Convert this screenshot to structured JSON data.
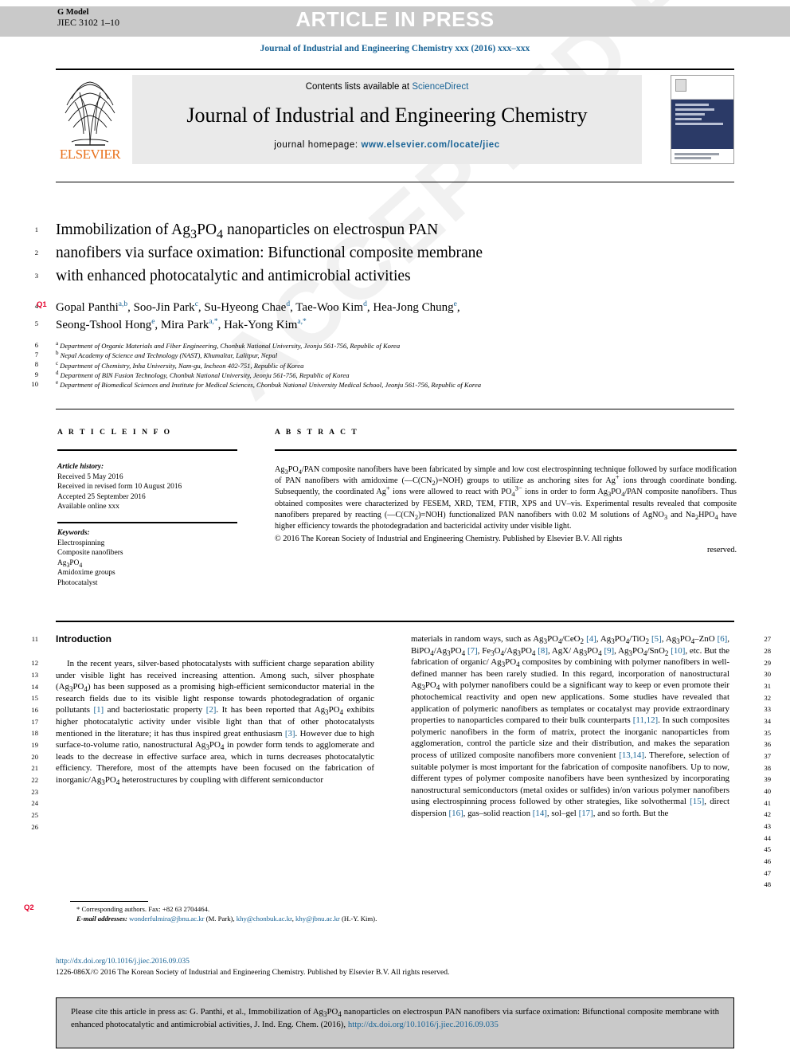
{
  "banner": {
    "g_model_label": "G Model",
    "g_model_code": "JIEC 3102 1–10",
    "article_in_press": "ARTICLE IN PRESS",
    "watermark": "ACCEPTED PROOF"
  },
  "running_head": "Journal of Industrial and Engineering Chemistry xxx (2016) xxx–xxx",
  "masthead": {
    "contents_prefix": "Contents lists available at ",
    "contents_link": "ScienceDirect",
    "journal_title": "Journal of Industrial and Engineering Chemistry",
    "homepage_label": "journal homepage: ",
    "homepage_url": "www.elsevier.com/locate/jiec",
    "publisher": "ELSEVIER",
    "accent_color": "#1a6496",
    "elsevier_orange": "#E9711C"
  },
  "article": {
    "title": "Immobilization of Ag3PO4 nanoparticles on electrospun PAN nanofibers via surface oximation: Bifunctional composite membrane with enhanced photocatalytic and antimicrobial activities",
    "authors": "Gopal Panthi a,b, Soo-Jin Park c, Su-Hyeong Chae d, Tae-Woo Kim d, Hea-Jong Chung e, Seong-Tshool Hong e, Mira Park a,*, Hak-Yong Kim a,*",
    "affiliations": [
      {
        "mark": "a",
        "text": "Department of Organic Materials and Fiber Engineering, Chonbuk National University, Jeonju 561-756, Republic of Korea"
      },
      {
        "mark": "b",
        "text": "Nepal Academy of Science and Technology (NAST), Khumaltar, Lalitpur, Nepal"
      },
      {
        "mark": "c",
        "text": "Department of Chemistry, Inha University, Nam-gu, Incheon 402-751, Republic of Korea"
      },
      {
        "mark": "d",
        "text": "Department of BIN Fusion Technology, Chonbuk National University, Jeonju 561-756, Republic of Korea"
      },
      {
        "mark": "e",
        "text": "Department of Biomedical Sciences and Institute for Medical Sciences, Chonbuk National University Medical School, Jeonju 561-756, Republic of Korea"
      }
    ]
  },
  "article_info": {
    "heading": "A R T I C L E   I N F O",
    "history_label": "Article history:",
    "history": [
      "Received 5 May 2016",
      "Received in revised form 10 August 2016",
      "Accepted 25 September 2016",
      "Available online xxx"
    ],
    "keywords_label": "Keywords:",
    "keywords": [
      "Electrospinning",
      "Composite nanofibers",
      "Ag3PO4",
      "Amidoxime groups",
      "Photocatalyst"
    ]
  },
  "abstract": {
    "heading": "A B S T R A C T",
    "body": "Ag3PO4/PAN composite nanofibers have been fabricated by simple and low cost electrospinning technique followed by surface modification of PAN nanofibers with amidoxime (—C(CN2)=NOH) groups to utilize as anchoring sites for Ag+ ions through coordinate bonding. Subsequently, the coordinated Ag+ ions were allowed to react with PO4 3− ions in order to form Ag3PO4/PAN composite nanofibers. Thus obtained composites were characterized by FESEM, XRD, TEM, FTIR, XPS and UV–vis. Experimental results revealed that composite nanofibers prepared by reacting (—C(CN2)=NOH) functionalized PAN nanofibers with 0.02 M solutions of AgNO3 and Na2HPO4 have higher efficiency towards the photodegradation and bactericidal activity under visible light.",
    "copyright": "© 2016 The Korean Society of Industrial and Engineering Chemistry. Published by Elsevier B.V. All rights",
    "reserved": "reserved."
  },
  "body": {
    "section_heading": "Introduction",
    "left_column": "In the recent years, silver-based photocatalysts with sufficient charge separation ability under visible light has received increasing attention. Among such, silver phosphate (Ag3PO4) has been supposed as a promising high-efficient semiconductor material in the research fields due to its visible light response towards photodegradation of organic pollutants [1] and bacteriostatic property [2]. It has been reported that Ag3PO4 exhibits higher photocatalytic activity under visible light than that of other photocatalysts mentioned in the literature; it has thus inspired great enthusiasm [3]. However due to high surface-to-volume ratio, nanostructural Ag3PO4 in powder form tends to agglomerate and leads to the decrease in effective surface area, which in turns decreases photocatalytic efficiency. Therefore, most of the attempts have been focused on the fabrication of inorganic/Ag3PO4 heterostructures by coupling with different semiconductor",
    "right_column": "materials in random ways, such as Ag3PO4/CeO2 [4], Ag3PO4/TiO2 [5], Ag3PO4–ZnO [6], BiPO4/Ag3PO4 [7], Fe3O4/Ag3PO4 [8], AgX/Ag3PO4 [9], Ag3PO4/SnO2 [10], etc. But the fabrication of organic/Ag3PO4 composites by combining with polymer nanofibers in well-defined manner has been rarely studied. In this regard, incorporation of nanostructural Ag3PO4 with polymer nanofibers could be a significant way to keep or even promote their photochemical reactivity and open new applications. Some studies have revealed that application of polymeric nanofibers as templates or cocatalyst may provide extraordinary properties to nanoparticles compared to their bulk counterparts [11,12]. In such composites polymeric nanofibers in the form of matrix, protect the inorganic nanoparticles from agglomeration, control the particle size and their distribution, and makes the separation process of utilized composite nanofibers more convenient [13,14]. Therefore, selection of suitable polymer is most important for the fabrication of composite nanofibers. Up to now, different types of polymer composite nanofibers have been synthesized by incorporating nanostructural semiconductors (metal oxides or sulfides) in/on various polymer nanofibers using electrospinning process followed by other strategies, like solvothermal [15], direct dispersion [16], gas–solid reaction [14], sol–gel [17], and so forth. But the"
  },
  "footnote": {
    "corresponding": "* Corresponding authors. Fax: +82 63 2704464.",
    "email_label": "E-mail addresses:",
    "emails": [
      {
        "addr": "wonderfulmira@jbnu.ac.kr",
        "who": "(M. Park),"
      },
      {
        "addr": "khy@chonbuk.ac.kr",
        "who": ","
      },
      {
        "addr": "khy@jbnu.ac.kr",
        "who": "(H.-Y. Kim)."
      }
    ],
    "doi": "http://dx.doi.org/10.1016/j.jiec.2016.09.035",
    "issn_line": "1226-086X/© 2016 The Korean Society of Industrial and Engineering Chemistry. Published by Elsevier B.V. All rights reserved."
  },
  "cite_box": {
    "text_before": "Please cite this article in press as: G. Panthi, et al., Immobilization of Ag3PO4 nanoparticles on electrospun PAN nanofibers via surface oximation: Bifunctional composite membrane with enhanced photocatalytic and antimicrobial activities, J. Ind. Eng. Chem. (2016), ",
    "link": "http://dx.doi.org/10.1016/j.jiec.2016.09.035"
  },
  "line_numbers": {
    "left": [
      "1",
      "2",
      "3",
      "4",
      "5",
      "6",
      "7",
      "8",
      "9",
      "10",
      "11",
      "12",
      "13",
      "14",
      "15",
      "16",
      "17",
      "18",
      "19",
      "20",
      "21",
      "22",
      "23",
      "24",
      "25",
      "26"
    ],
    "right": [
      "27",
      "28",
      "29",
      "30",
      "31",
      "32",
      "33",
      "34",
      "35",
      "36",
      "37",
      "38",
      "39",
      "40",
      "41",
      "42",
      "43",
      "44",
      "45",
      "46",
      "47",
      "48"
    ],
    "queries": [
      {
        "id": "Q1"
      },
      {
        "id": "Q2"
      }
    ]
  }
}
